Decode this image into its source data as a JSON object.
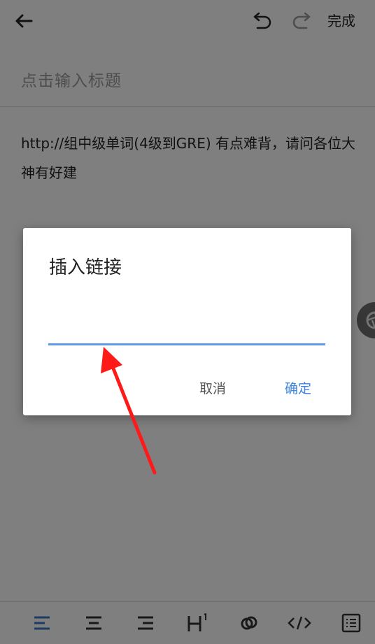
{
  "header": {
    "back_icon": "arrow-left-icon",
    "undo_icon": "undo-icon",
    "redo_icon": "redo-icon",
    "done_label": "完成"
  },
  "editor": {
    "title_placeholder": "点击输入标题",
    "body_text": "http://组中级单词(4级到GRE) 有点难背，请问各位大神有好建"
  },
  "dialog": {
    "title": "插入链接",
    "input_value": "",
    "cancel_label": "取消",
    "confirm_label": "确定"
  },
  "toolbar": {
    "tools": [
      "align-left-icon",
      "align-center-icon",
      "align-right-icon",
      "heading-1-icon",
      "link-icon",
      "code-icon",
      "list-icon"
    ]
  },
  "colors": {
    "accent": "#3b86e0",
    "input_underline": "#5b9be8",
    "annotation_arrow": "#ff1a1a",
    "overlay": "rgba(0,0,0,0.5)"
  }
}
